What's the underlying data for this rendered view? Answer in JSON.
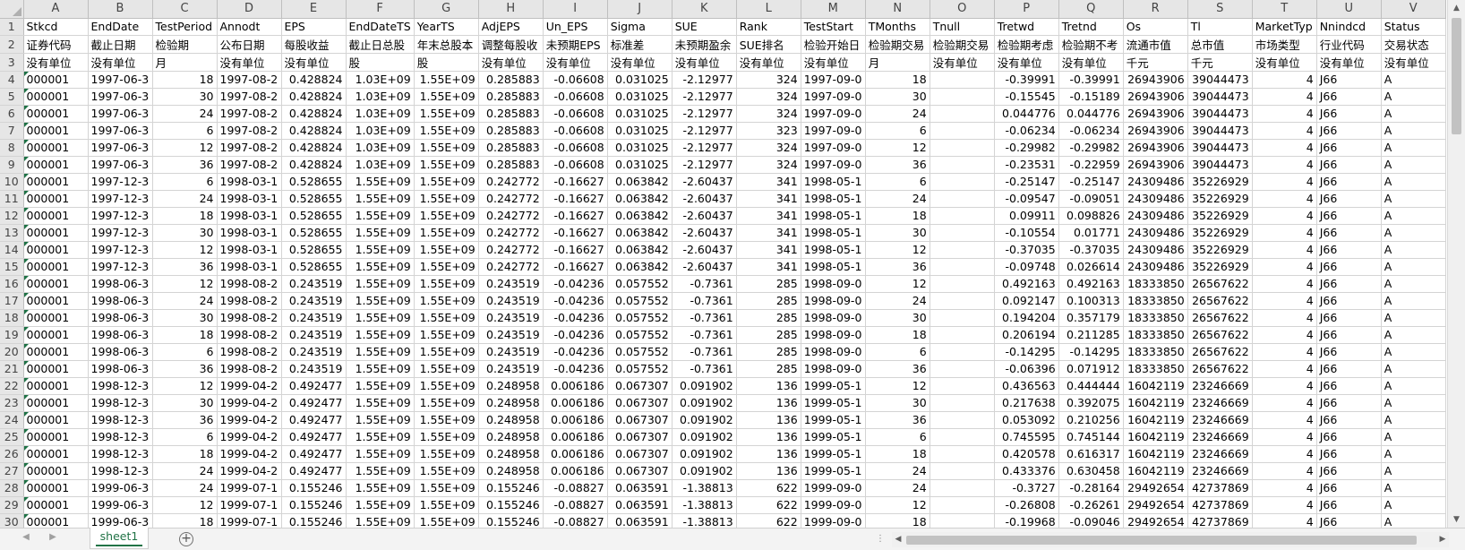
{
  "sheet_tab": {
    "label": "sheet1"
  },
  "columns": [
    "A",
    "B",
    "C",
    "D",
    "E",
    "F",
    "G",
    "H",
    "I",
    "J",
    "K",
    "L",
    "M",
    "N",
    "O",
    "P",
    "Q",
    "R",
    "S",
    "T",
    "U",
    "V"
  ],
  "row_numbers": [
    "1",
    "2",
    "3",
    "4",
    "5",
    "6",
    "7",
    "8",
    "9",
    "10",
    "11",
    "12",
    "13",
    "14",
    "15",
    "16",
    "17",
    "18",
    "19",
    "20",
    "21",
    "22",
    "23",
    "24",
    "25",
    "26",
    "27",
    "28",
    "29",
    "30"
  ],
  "rows": [
    [
      "Stkcd",
      "EndDate",
      "TestPeriod",
      "Annodt",
      "EPS",
      "EndDateTS",
      "YearTS",
      "AdjEPS",
      "Un_EPS",
      "Sigma",
      "SUE",
      "Rank",
      "TestStart",
      "TMonths",
      "Tnull",
      "Tretwd",
      "Tretnd",
      "Os",
      "Tl",
      "MarketTyp",
      "Nnindcd",
      "Status"
    ],
    [
      "证券代码",
      "截止日期",
      "检验期",
      "公布日期",
      "每股收益",
      "截止日总股",
      "年末总股本",
      "调整每股收",
      "未预期EPS",
      "标准差",
      "未预期盈余",
      "SUE排名",
      "检验开始日",
      "检验期交易",
      "检验期交易",
      "检验期考虑",
      "检验期不考",
      "流通市值",
      "总市值",
      "市场类型",
      "行业代码",
      "交易状态"
    ],
    [
      "没有单位",
      "没有单位",
      "月",
      "没有单位",
      "没有单位",
      "股",
      "股",
      "没有单位",
      "没有单位",
      "没有单位",
      "没有单位",
      "没有单位",
      "没有单位",
      "月",
      "没有单位",
      "没有单位",
      "没有单位",
      "千元",
      "千元",
      "没有单位",
      "没有单位",
      "没有单位"
    ],
    [
      "000001",
      "1997-06-3",
      "18",
      "1997-08-2",
      "0.428824",
      "1.03E+09",
      "1.55E+09",
      "0.285883",
      "-0.06608",
      "0.031025",
      "-2.12977",
      "324",
      "1997-09-0",
      "18",
      "",
      "-0.39991",
      "-0.39991",
      "26943906",
      "39044473",
      "4",
      "J66",
      "A"
    ],
    [
      "000001",
      "1997-06-3",
      "30",
      "1997-08-2",
      "0.428824",
      "1.03E+09",
      "1.55E+09",
      "0.285883",
      "-0.06608",
      "0.031025",
      "-2.12977",
      "324",
      "1997-09-0",
      "30",
      "",
      "-0.15545",
      "-0.15189",
      "26943906",
      "39044473",
      "4",
      "J66",
      "A"
    ],
    [
      "000001",
      "1997-06-3",
      "24",
      "1997-08-2",
      "0.428824",
      "1.03E+09",
      "1.55E+09",
      "0.285883",
      "-0.06608",
      "0.031025",
      "-2.12977",
      "324",
      "1997-09-0",
      "24",
      "",
      "0.044776",
      "0.044776",
      "26943906",
      "39044473",
      "4",
      "J66",
      "A"
    ],
    [
      "000001",
      "1997-06-3",
      "6",
      "1997-08-2",
      "0.428824",
      "1.03E+09",
      "1.55E+09",
      "0.285883",
      "-0.06608",
      "0.031025",
      "-2.12977",
      "323",
      "1997-09-0",
      "6",
      "",
      "-0.06234",
      "-0.06234",
      "26943906",
      "39044473",
      "4",
      "J66",
      "A"
    ],
    [
      "000001",
      "1997-06-3",
      "12",
      "1997-08-2",
      "0.428824",
      "1.03E+09",
      "1.55E+09",
      "0.285883",
      "-0.06608",
      "0.031025",
      "-2.12977",
      "324",
      "1997-09-0",
      "12",
      "",
      "-0.29982",
      "-0.29982",
      "26943906",
      "39044473",
      "4",
      "J66",
      "A"
    ],
    [
      "000001",
      "1997-06-3",
      "36",
      "1997-08-2",
      "0.428824",
      "1.03E+09",
      "1.55E+09",
      "0.285883",
      "-0.06608",
      "0.031025",
      "-2.12977",
      "324",
      "1997-09-0",
      "36",
      "",
      "-0.23531",
      "-0.22959",
      "26943906",
      "39044473",
      "4",
      "J66",
      "A"
    ],
    [
      "000001",
      "1997-12-3",
      "6",
      "1998-03-1",
      "0.528655",
      "1.55E+09",
      "1.55E+09",
      "0.242772",
      "-0.16627",
      "0.063842",
      "-2.60437",
      "341",
      "1998-05-1",
      "6",
      "",
      "-0.25147",
      "-0.25147",
      "24309486",
      "35226929",
      "4",
      "J66",
      "A"
    ],
    [
      "000001",
      "1997-12-3",
      "24",
      "1998-03-1",
      "0.528655",
      "1.55E+09",
      "1.55E+09",
      "0.242772",
      "-0.16627",
      "0.063842",
      "-2.60437",
      "341",
      "1998-05-1",
      "24",
      "",
      "-0.09547",
      "-0.09051",
      "24309486",
      "35226929",
      "4",
      "J66",
      "A"
    ],
    [
      "000001",
      "1997-12-3",
      "18",
      "1998-03-1",
      "0.528655",
      "1.55E+09",
      "1.55E+09",
      "0.242772",
      "-0.16627",
      "0.063842",
      "-2.60437",
      "341",
      "1998-05-1",
      "18",
      "",
      "0.09911",
      "0.098826",
      "24309486",
      "35226929",
      "4",
      "J66",
      "A"
    ],
    [
      "000001",
      "1997-12-3",
      "30",
      "1998-03-1",
      "0.528655",
      "1.55E+09",
      "1.55E+09",
      "0.242772",
      "-0.16627",
      "0.063842",
      "-2.60437",
      "341",
      "1998-05-1",
      "30",
      "",
      "-0.10554",
      "0.01771",
      "24309486",
      "35226929",
      "4",
      "J66",
      "A"
    ],
    [
      "000001",
      "1997-12-3",
      "12",
      "1998-03-1",
      "0.528655",
      "1.55E+09",
      "1.55E+09",
      "0.242772",
      "-0.16627",
      "0.063842",
      "-2.60437",
      "341",
      "1998-05-1",
      "12",
      "",
      "-0.37035",
      "-0.37035",
      "24309486",
      "35226929",
      "4",
      "J66",
      "A"
    ],
    [
      "000001",
      "1997-12-3",
      "36",
      "1998-03-1",
      "0.528655",
      "1.55E+09",
      "1.55E+09",
      "0.242772",
      "-0.16627",
      "0.063842",
      "-2.60437",
      "341",
      "1998-05-1",
      "36",
      "",
      "-0.09748",
      "0.026614",
      "24309486",
      "35226929",
      "4",
      "J66",
      "A"
    ],
    [
      "000001",
      "1998-06-3",
      "12",
      "1998-08-2",
      "0.243519",
      "1.55E+09",
      "1.55E+09",
      "0.243519",
      "-0.04236",
      "0.057552",
      "-0.7361",
      "285",
      "1998-09-0",
      "12",
      "",
      "0.492163",
      "0.492163",
      "18333850",
      "26567622",
      "4",
      "J66",
      "A"
    ],
    [
      "000001",
      "1998-06-3",
      "24",
      "1998-08-2",
      "0.243519",
      "1.55E+09",
      "1.55E+09",
      "0.243519",
      "-0.04236",
      "0.057552",
      "-0.7361",
      "285",
      "1998-09-0",
      "24",
      "",
      "0.092147",
      "0.100313",
      "18333850",
      "26567622",
      "4",
      "J66",
      "A"
    ],
    [
      "000001",
      "1998-06-3",
      "30",
      "1998-08-2",
      "0.243519",
      "1.55E+09",
      "1.55E+09",
      "0.243519",
      "-0.04236",
      "0.057552",
      "-0.7361",
      "285",
      "1998-09-0",
      "30",
      "",
      "0.194204",
      "0.357179",
      "18333850",
      "26567622",
      "4",
      "J66",
      "A"
    ],
    [
      "000001",
      "1998-06-3",
      "18",
      "1998-08-2",
      "0.243519",
      "1.55E+09",
      "1.55E+09",
      "0.243519",
      "-0.04236",
      "0.057552",
      "-0.7361",
      "285",
      "1998-09-0",
      "18",
      "",
      "0.206194",
      "0.211285",
      "18333850",
      "26567622",
      "4",
      "J66",
      "A"
    ],
    [
      "000001",
      "1998-06-3",
      "6",
      "1998-08-2",
      "0.243519",
      "1.55E+09",
      "1.55E+09",
      "0.243519",
      "-0.04236",
      "0.057552",
      "-0.7361",
      "285",
      "1998-09-0",
      "6",
      "",
      "-0.14295",
      "-0.14295",
      "18333850",
      "26567622",
      "4",
      "J66",
      "A"
    ],
    [
      "000001",
      "1998-06-3",
      "36",
      "1998-08-2",
      "0.243519",
      "1.55E+09",
      "1.55E+09",
      "0.243519",
      "-0.04236",
      "0.057552",
      "-0.7361",
      "285",
      "1998-09-0",
      "36",
      "",
      "-0.06396",
      "0.071912",
      "18333850",
      "26567622",
      "4",
      "J66",
      "A"
    ],
    [
      "000001",
      "1998-12-3",
      "12",
      "1999-04-2",
      "0.492477",
      "1.55E+09",
      "1.55E+09",
      "0.248958",
      "0.006186",
      "0.067307",
      "0.091902",
      "136",
      "1999-05-1",
      "12",
      "",
      "0.436563",
      "0.444444",
      "16042119",
      "23246669",
      "4",
      "J66",
      "A"
    ],
    [
      "000001",
      "1998-12-3",
      "30",
      "1999-04-2",
      "0.492477",
      "1.55E+09",
      "1.55E+09",
      "0.248958",
      "0.006186",
      "0.067307",
      "0.091902",
      "136",
      "1999-05-1",
      "30",
      "",
      "0.217638",
      "0.392075",
      "16042119",
      "23246669",
      "4",
      "J66",
      "A"
    ],
    [
      "000001",
      "1998-12-3",
      "36",
      "1999-04-2",
      "0.492477",
      "1.55E+09",
      "1.55E+09",
      "0.248958",
      "0.006186",
      "0.067307",
      "0.091902",
      "136",
      "1999-05-1",
      "36",
      "",
      "0.053092",
      "0.210256",
      "16042119",
      "23246669",
      "4",
      "J66",
      "A"
    ],
    [
      "000001",
      "1998-12-3",
      "6",
      "1999-04-2",
      "0.492477",
      "1.55E+09",
      "1.55E+09",
      "0.248958",
      "0.006186",
      "0.067307",
      "0.091902",
      "136",
      "1999-05-1",
      "6",
      "",
      "0.745595",
      "0.745144",
      "16042119",
      "23246669",
      "4",
      "J66",
      "A"
    ],
    [
      "000001",
      "1998-12-3",
      "18",
      "1999-04-2",
      "0.492477",
      "1.55E+09",
      "1.55E+09",
      "0.248958",
      "0.006186",
      "0.067307",
      "0.091902",
      "136",
      "1999-05-1",
      "18",
      "",
      "0.420578",
      "0.616317",
      "16042119",
      "23246669",
      "4",
      "J66",
      "A"
    ],
    [
      "000001",
      "1998-12-3",
      "24",
      "1999-04-2",
      "0.492477",
      "1.55E+09",
      "1.55E+09",
      "0.248958",
      "0.006186",
      "0.067307",
      "0.091902",
      "136",
      "1999-05-1",
      "24",
      "",
      "0.433376",
      "0.630458",
      "16042119",
      "23246669",
      "4",
      "J66",
      "A"
    ],
    [
      "000001",
      "1999-06-3",
      "24",
      "1999-07-1",
      "0.155246",
      "1.55E+09",
      "1.55E+09",
      "0.155246",
      "-0.08827",
      "0.063591",
      "-1.38813",
      "622",
      "1999-09-0",
      "24",
      "",
      "-0.3727",
      "-0.28164",
      "29492654",
      "42737869",
      "4",
      "J66",
      "A"
    ],
    [
      "000001",
      "1999-06-3",
      "12",
      "1999-07-1",
      "0.155246",
      "1.55E+09",
      "1.55E+09",
      "0.155246",
      "-0.08827",
      "0.063591",
      "-1.38813",
      "622",
      "1999-09-0",
      "12",
      "",
      "-0.26808",
      "-0.26261",
      "29492654",
      "42737869",
      "4",
      "J66",
      "A"
    ],
    [
      "000001",
      "1999-06-3",
      "18",
      "1999-07-1",
      "0.155246",
      "1.55E+09",
      "1.55E+09",
      "0.155246",
      "-0.08827",
      "0.063591",
      "-1.38813",
      "622",
      "1999-09-0",
      "18",
      "",
      "-0.19968",
      "-0.09046",
      "29492654",
      "42737869",
      "4",
      "J66",
      "A"
    ]
  ]
}
